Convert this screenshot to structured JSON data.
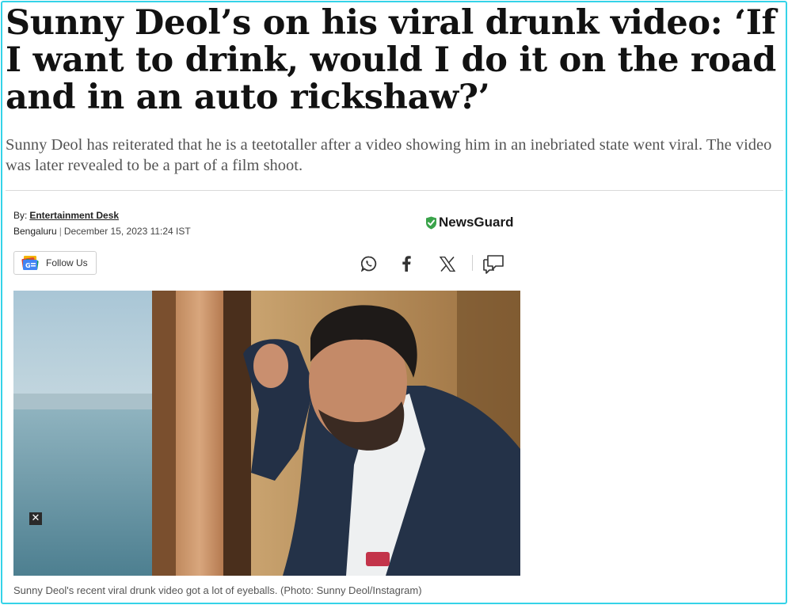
{
  "article": {
    "headline": "Sunny Deol’s on his viral drunk video: ‘If I want to drink, would I do it on the road and in an auto rickshaw?’",
    "summary": "Sunny Deol has reiterated that he is a teetotaller after a video showing him in an inebriated state went viral. The video was later revealed to be a part of a film shoot.",
    "byline_prefix": "By:",
    "author": "Entertainment Desk",
    "location": "Bengaluru",
    "separator": "|",
    "datetime": "December 15, 2023 11:24 IST"
  },
  "badges": {
    "newsguard_label": "NewsGuard"
  },
  "actions": {
    "follow_label": "Follow Us",
    "share_icons": [
      "whatsapp-icon",
      "facebook-icon",
      "x-icon",
      "comments-icon"
    ]
  },
  "media": {
    "close_symbol": "✕",
    "caption": "Sunny Deol's recent viral drunk video got a lot of eyeballs. (Photo: Sunny Deol/Instagram)"
  },
  "colors": {
    "frame": "#34d3e8",
    "newsguard_green": "#3aa34a"
  }
}
